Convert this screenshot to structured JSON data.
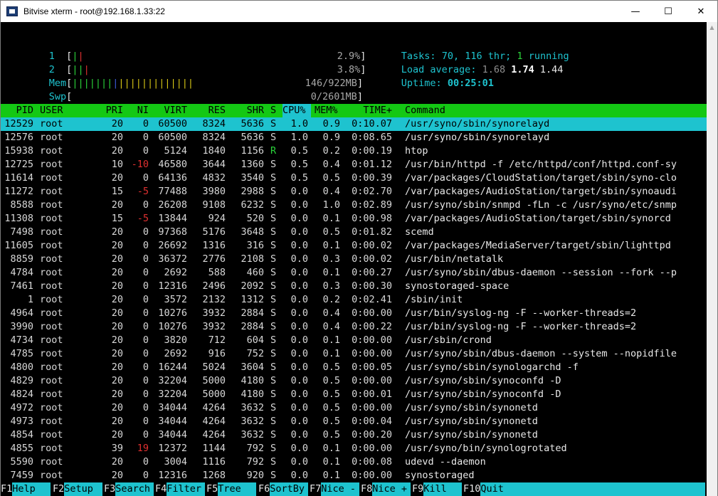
{
  "window": {
    "title": "Bitvise xterm - root@192.168.1.33:22",
    "minimize": "—",
    "maximize": "☐",
    "close": "✕"
  },
  "meters": {
    "cpu1": {
      "label": "1",
      "value": "2.9%"
    },
    "cpu2": {
      "label": "2",
      "value": "3.8%"
    },
    "mem": {
      "label": "Mem",
      "value": "146/922MB"
    },
    "swp": {
      "label": "Swp",
      "value": "0/2601MB"
    }
  },
  "summary": {
    "tasks_label": "Tasks:",
    "tasks": "70,",
    "threads": "116",
    "thr_label": "thr;",
    "running": "1",
    "running_label": "running",
    "load_label": "Load average:",
    "load1": "1.68",
    "load5": "1.74",
    "load15": "1.44",
    "uptime_label": "Uptime:",
    "uptime": "00:25:01"
  },
  "columns": {
    "pid": "PID",
    "user": "USER",
    "pri": "PRI",
    "ni": "NI",
    "virt": "VIRT",
    "res": "RES",
    "shr": "SHR",
    "s": "S",
    "cpu": "CPU%",
    "mem": "MEM%",
    "time": "TIME+",
    "command": "Command"
  },
  "processes": [
    {
      "pid": "12529",
      "user": "root",
      "pri": "20",
      "ni": "0",
      "virt": "60500",
      "res": "8324",
      "shr": "5636",
      "s": "S",
      "cpu": "1.0",
      "mem": "0.9",
      "time": "0:10.07",
      "command": "/usr/syno/sbin/synorelayd"
    },
    {
      "pid": "12576",
      "user": "root",
      "pri": "20",
      "ni": "0",
      "virt": "60500",
      "res": "8324",
      "shr": "5636",
      "s": "S",
      "cpu": "1.0",
      "mem": "0.9",
      "time": "0:08.65",
      "command": "/usr/syno/sbin/synorelayd"
    },
    {
      "pid": "15938",
      "user": "root",
      "pri": "20",
      "ni": "0",
      "virt": "5124",
      "res": "1840",
      "shr": "1156",
      "s": "R",
      "cpu": "0.5",
      "mem": "0.2",
      "time": "0:00.19",
      "command": "htop"
    },
    {
      "pid": "12725",
      "user": "root",
      "pri": "10",
      "ni": "-10",
      "virt": "46580",
      "res": "3644",
      "shr": "1360",
      "s": "S",
      "cpu": "0.5",
      "mem": "0.4",
      "time": "0:01.12",
      "command": "/usr/bin/httpd -f /etc/httpd/conf/httpd.conf-sy"
    },
    {
      "pid": "11614",
      "user": "root",
      "pri": "20",
      "ni": "0",
      "virt": "64136",
      "res": "4832",
      "shr": "3540",
      "s": "S",
      "cpu": "0.5",
      "mem": "0.5",
      "time": "0:00.39",
      "command": "/var/packages/CloudStation/target/sbin/syno-clo"
    },
    {
      "pid": "11272",
      "user": "root",
      "pri": "15",
      "ni": "-5",
      "virt": "77488",
      "res": "3980",
      "shr": "2988",
      "s": "S",
      "cpu": "0.0",
      "mem": "0.4",
      "time": "0:02.70",
      "command": "/var/packages/AudioStation/target/sbin/synoaudi"
    },
    {
      "pid": "8588",
      "user": "root",
      "pri": "20",
      "ni": "0",
      "virt": "26208",
      "res": "9108",
      "shr": "6232",
      "s": "S",
      "cpu": "0.0",
      "mem": "1.0",
      "time": "0:02.89",
      "command": "/usr/syno/sbin/snmpd -fLn -c /usr/syno/etc/snmp"
    },
    {
      "pid": "11308",
      "user": "root",
      "pri": "15",
      "ni": "-5",
      "virt": "13844",
      "res": "924",
      "shr": "520",
      "s": "S",
      "cpu": "0.0",
      "mem": "0.1",
      "time": "0:00.98",
      "command": "/var/packages/AudioStation/target/sbin/synorcd"
    },
    {
      "pid": "7498",
      "user": "root",
      "pri": "20",
      "ni": "0",
      "virt": "97368",
      "res": "5176",
      "shr": "3648",
      "s": "S",
      "cpu": "0.0",
      "mem": "0.5",
      "time": "0:01.82",
      "command": "scemd"
    },
    {
      "pid": "11605",
      "user": "root",
      "pri": "20",
      "ni": "0",
      "virt": "26692",
      "res": "1316",
      "shr": "316",
      "s": "S",
      "cpu": "0.0",
      "mem": "0.1",
      "time": "0:00.02",
      "command": "/var/packages/MediaServer/target/sbin/lighttpd"
    },
    {
      "pid": "8859",
      "user": "root",
      "pri": "20",
      "ni": "0",
      "virt": "36372",
      "res": "2776",
      "shr": "2108",
      "s": "S",
      "cpu": "0.0",
      "mem": "0.3",
      "time": "0:00.02",
      "command": "/usr/bin/netatalk"
    },
    {
      "pid": "4784",
      "user": "root",
      "pri": "20",
      "ni": "0",
      "virt": "2692",
      "res": "588",
      "shr": "460",
      "s": "S",
      "cpu": "0.0",
      "mem": "0.1",
      "time": "0:00.27",
      "command": "/usr/syno/sbin/dbus-daemon --session --fork --p"
    },
    {
      "pid": "7461",
      "user": "root",
      "pri": "20",
      "ni": "0",
      "virt": "12316",
      "res": "2496",
      "shr": "2092",
      "s": "S",
      "cpu": "0.0",
      "mem": "0.3",
      "time": "0:00.30",
      "command": "synostoraged-space"
    },
    {
      "pid": "1",
      "user": "root",
      "pri": "20",
      "ni": "0",
      "virt": "3572",
      "res": "2132",
      "shr": "1312",
      "s": "S",
      "cpu": "0.0",
      "mem": "0.2",
      "time": "0:02.41",
      "command": "/sbin/init"
    },
    {
      "pid": "4964",
      "user": "root",
      "pri": "20",
      "ni": "0",
      "virt": "10276",
      "res": "3932",
      "shr": "2884",
      "s": "S",
      "cpu": "0.0",
      "mem": "0.4",
      "time": "0:00.00",
      "command": "/usr/bin/syslog-ng -F --worker-threads=2"
    },
    {
      "pid": "3990",
      "user": "root",
      "pri": "20",
      "ni": "0",
      "virt": "10276",
      "res": "3932",
      "shr": "2884",
      "s": "S",
      "cpu": "0.0",
      "mem": "0.4",
      "time": "0:00.22",
      "command": "/usr/bin/syslog-ng -F --worker-threads=2"
    },
    {
      "pid": "4734",
      "user": "root",
      "pri": "20",
      "ni": "0",
      "virt": "3820",
      "res": "712",
      "shr": "604",
      "s": "S",
      "cpu": "0.0",
      "mem": "0.1",
      "time": "0:00.00",
      "command": "/usr/sbin/crond"
    },
    {
      "pid": "4785",
      "user": "root",
      "pri": "20",
      "ni": "0",
      "virt": "2692",
      "res": "916",
      "shr": "752",
      "s": "S",
      "cpu": "0.0",
      "mem": "0.1",
      "time": "0:00.00",
      "command": "/usr/syno/sbin/dbus-daemon --system --nopidfile"
    },
    {
      "pid": "4800",
      "user": "root",
      "pri": "20",
      "ni": "0",
      "virt": "16244",
      "res": "5024",
      "shr": "3604",
      "s": "S",
      "cpu": "0.0",
      "mem": "0.5",
      "time": "0:00.05",
      "command": "/usr/syno/sbin/synologarchd -f"
    },
    {
      "pid": "4829",
      "user": "root",
      "pri": "20",
      "ni": "0",
      "virt": "32204",
      "res": "5000",
      "shr": "4180",
      "s": "S",
      "cpu": "0.0",
      "mem": "0.5",
      "time": "0:00.00",
      "command": "/usr/syno/sbin/synoconfd -D"
    },
    {
      "pid": "4824",
      "user": "root",
      "pri": "20",
      "ni": "0",
      "virt": "32204",
      "res": "5000",
      "shr": "4180",
      "s": "S",
      "cpu": "0.0",
      "mem": "0.5",
      "time": "0:00.01",
      "command": "/usr/syno/sbin/synoconfd -D"
    },
    {
      "pid": "4972",
      "user": "root",
      "pri": "20",
      "ni": "0",
      "virt": "34044",
      "res": "4264",
      "shr": "3632",
      "s": "S",
      "cpu": "0.0",
      "mem": "0.5",
      "time": "0:00.00",
      "command": "/usr/syno/sbin/synonetd"
    },
    {
      "pid": "4973",
      "user": "root",
      "pri": "20",
      "ni": "0",
      "virt": "34044",
      "res": "4264",
      "shr": "3632",
      "s": "S",
      "cpu": "0.0",
      "mem": "0.5",
      "time": "0:00.04",
      "command": "/usr/syno/sbin/synonetd"
    },
    {
      "pid": "4854",
      "user": "root",
      "pri": "20",
      "ni": "0",
      "virt": "34044",
      "res": "4264",
      "shr": "3632",
      "s": "S",
      "cpu": "0.0",
      "mem": "0.5",
      "time": "0:00.20",
      "command": "/usr/syno/sbin/synonetd"
    },
    {
      "pid": "4855",
      "user": "root",
      "pri": "39",
      "ni": "19",
      "virt": "12372",
      "res": "1144",
      "shr": "792",
      "s": "S",
      "cpu": "0.0",
      "mem": "0.1",
      "time": "0:00.00",
      "command": "/usr/syno/bin/synologrotated"
    },
    {
      "pid": "5590",
      "user": "root",
      "pri": "20",
      "ni": "0",
      "virt": "3004",
      "res": "1116",
      "shr": "792",
      "s": "S",
      "cpu": "0.0",
      "mem": "0.1",
      "time": "0:00.08",
      "command": "udevd --daemon"
    },
    {
      "pid": "7459",
      "user": "root",
      "pri": "20",
      "ni": "0",
      "virt": "12316",
      "res": "1268",
      "shr": "920",
      "s": "S",
      "cpu": "0.0",
      "mem": "0.1",
      "time": "0:00.00",
      "command": "synostoraged"
    }
  ],
  "footer": [
    {
      "key": "F1",
      "label": "Help"
    },
    {
      "key": "F2",
      "label": "Setup"
    },
    {
      "key": "F3",
      "label": "Search"
    },
    {
      "key": "F4",
      "label": "Filter"
    },
    {
      "key": "F5",
      "label": "Tree"
    },
    {
      "key": "F6",
      "label": "SortBy"
    },
    {
      "key": "F7",
      "label": "Nice -"
    },
    {
      "key": "F8",
      "label": "Nice +"
    },
    {
      "key": "F9",
      "label": "Kill"
    },
    {
      "key": "F10",
      "label": "Quit"
    }
  ]
}
